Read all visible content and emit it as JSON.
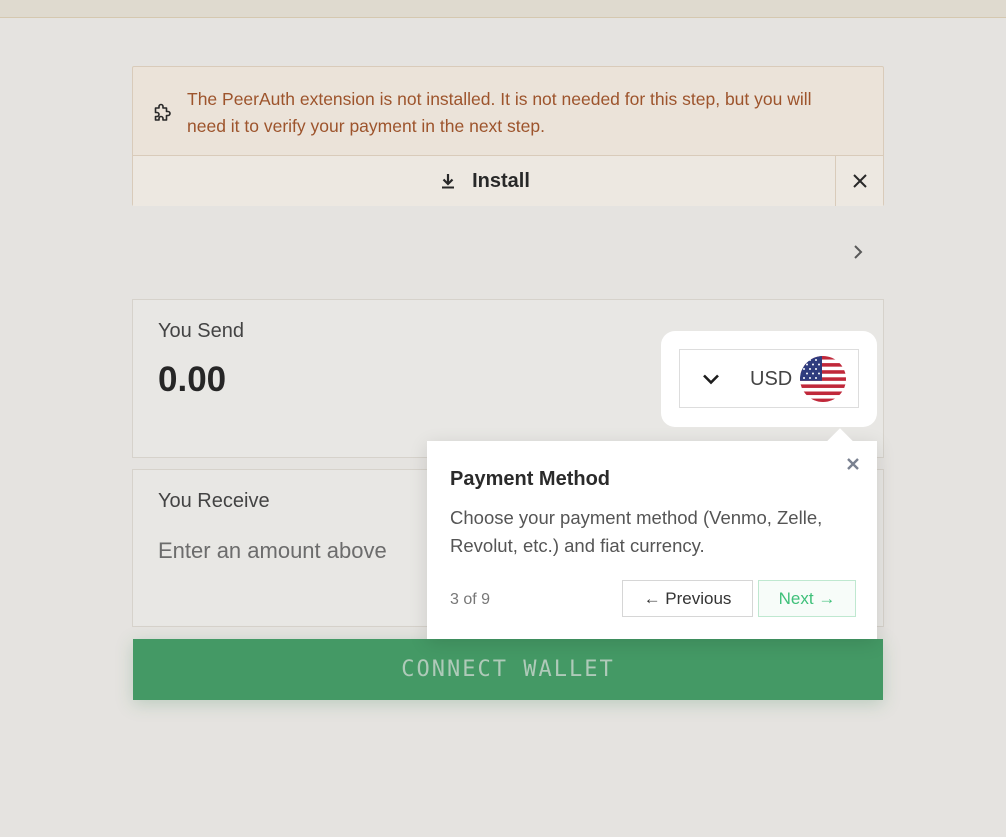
{
  "banner": {
    "message": "The PeerAuth extension is not installed. It is not needed for this step, but you will need it to verify your payment in the next step.",
    "install_label": "Install"
  },
  "send": {
    "label": "You Send",
    "amount": "0.00",
    "currency": "USD"
  },
  "receive": {
    "label": "You Receive",
    "placeholder": "Enter an amount above"
  },
  "connect_wallet_label": "CONNECT WALLET",
  "tour": {
    "title": "Payment Method",
    "body": "Choose your payment method (Venmo, Zelle, Revolut, etc.) and fiat currency.",
    "progress": "3 of 9",
    "previous_label": "← Previous",
    "next_label": "Next →"
  },
  "icons": {
    "banner": "puzzle-icon",
    "install": "download-icon",
    "dismiss": "close-icon",
    "route": "chevron-right-icon",
    "currency_toggle": "chevron-down-icon",
    "currency_flag": "us-flag-icon"
  },
  "colors": {
    "warning_text": "#a24f22",
    "connect_button": "#3d9e62",
    "next_accent": "#3fc07a"
  }
}
